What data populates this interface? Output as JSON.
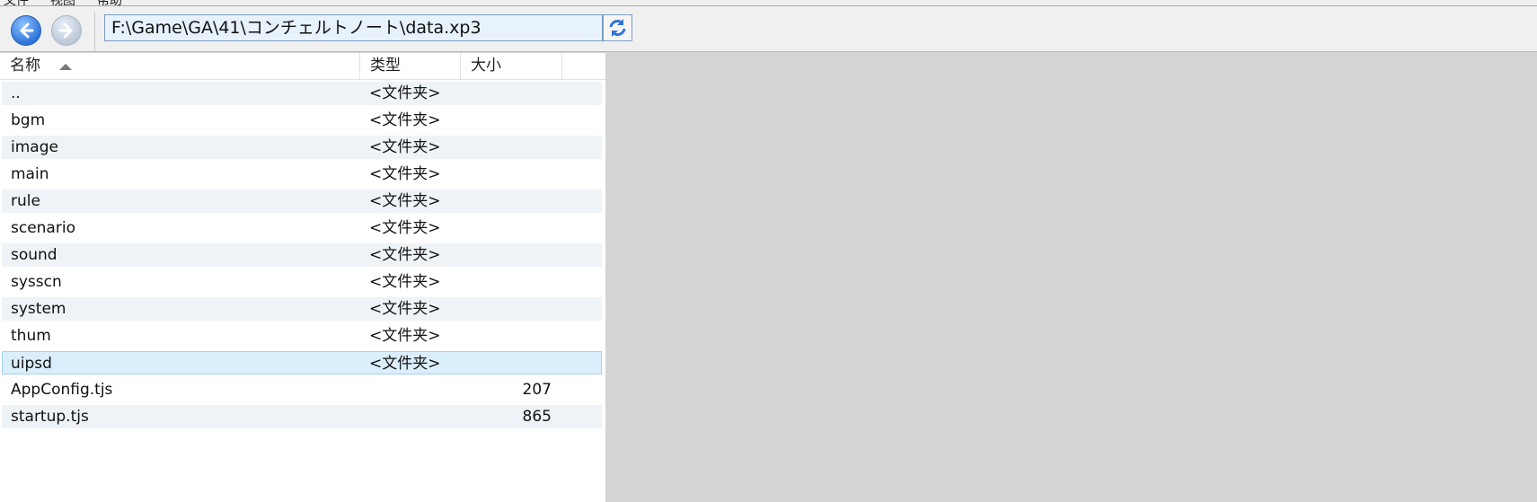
{
  "address": {
    "path": "F:\\Game\\GA\\41\\コンチェルトノート\\data.xp3"
  },
  "columns": {
    "name": "名称",
    "type": "类型",
    "size": "大小"
  },
  "rows": [
    {
      "name": "..",
      "type": "<文件夹>",
      "size": ""
    },
    {
      "name": "bgm",
      "type": "<文件夹>",
      "size": ""
    },
    {
      "name": "image",
      "type": "<文件夹>",
      "size": ""
    },
    {
      "name": "main",
      "type": "<文件夹>",
      "size": ""
    },
    {
      "name": "rule",
      "type": "<文件夹>",
      "size": ""
    },
    {
      "name": "scenario",
      "type": "<文件夹>",
      "size": ""
    },
    {
      "name": "sound",
      "type": "<文件夹>",
      "size": ""
    },
    {
      "name": "sysscn",
      "type": "<文件夹>",
      "size": ""
    },
    {
      "name": "system",
      "type": "<文件夹>",
      "size": ""
    },
    {
      "name": "thum",
      "type": "<文件夹>",
      "size": ""
    },
    {
      "name": "uipsd",
      "type": "<文件夹>",
      "size": ""
    },
    {
      "name": "AppConfig.tjs",
      "type": "",
      "size": "207"
    },
    {
      "name": "startup.tjs",
      "type": "",
      "size": "865"
    }
  ],
  "selected_row": "uipsd",
  "icons": {
    "back": "back-arrow-icon",
    "forward": "forward-arrow-icon",
    "refresh": "refresh-icon",
    "sort": "sort-ascending-icon"
  },
  "colors": {
    "accent": "#2e74d9",
    "selection": "#dbeefb",
    "alt_row": "#eef3f8",
    "empty_area": "#d4d4d4"
  }
}
